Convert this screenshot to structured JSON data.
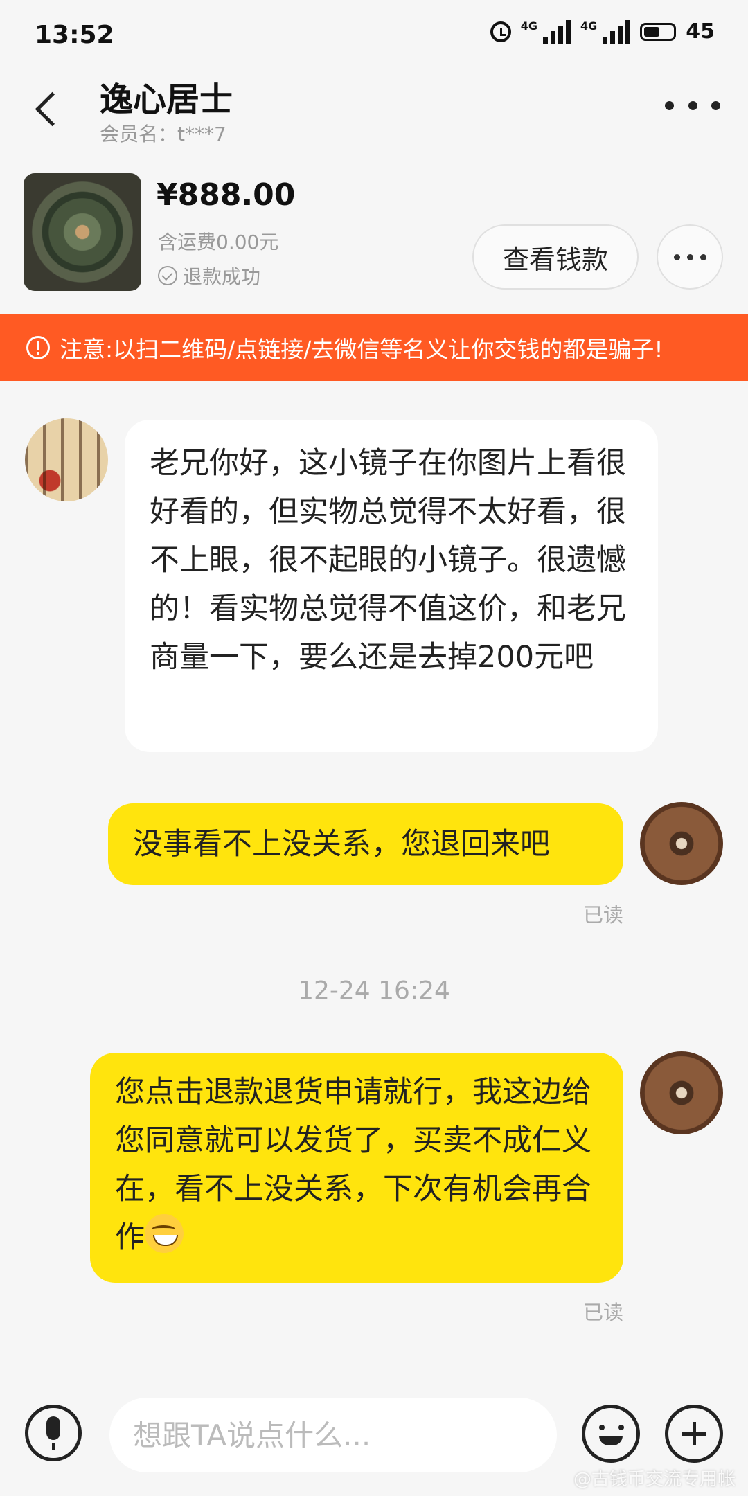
{
  "status_bar": {
    "time": "13:52",
    "network_1": "4G",
    "network_2": "4G",
    "battery": "45"
  },
  "header": {
    "title": "逸心居士",
    "subtitle": "会员名：t***7"
  },
  "product": {
    "price": "¥888.00",
    "shipping": "含运费0.00元",
    "status": "退款成功",
    "view_button": "查看钱款"
  },
  "warning": {
    "text": "注意:以扫二维码/点链接/去微信等名义让你交钱的都是骗子!"
  },
  "messages": [
    {
      "sender": "other",
      "text": "老兄你好，这小镜子在你图片上看很好看的，但实物总觉得不太好看，很不上眼，很不起眼的小镜子。很遗憾的！看实物总觉得不值这价，和老兄商量一下，要么还是去掉200元吧"
    },
    {
      "sender": "self",
      "text": "没事看不上没关系，您退回来吧",
      "read_status": "已读"
    },
    {
      "sender": "self",
      "text": "您点击退款退货申请就行，我这边给您同意就可以发货了，买卖不成仁义在，看不上没关系，下次有机会再合作",
      "emoji": "grinning-face",
      "read_status": "已读"
    }
  ],
  "timestamp": "12-24 16:24",
  "input": {
    "placeholder": "想跟TA说点什么..."
  },
  "watermark": "@古钱币交流专用帐",
  "colors": {
    "accent_yellow": "#ffe40d",
    "warning_orange": "#ff5a23",
    "background": "#f6f6f6"
  }
}
